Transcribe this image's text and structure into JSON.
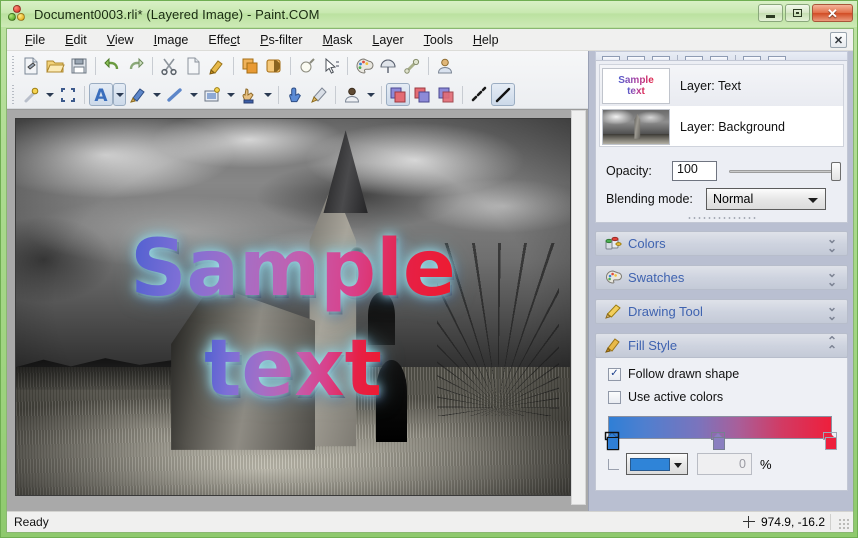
{
  "window": {
    "title": "Document0003.rli* (Layered Image) - Paint.COM",
    "app_icon": "paint-palette-icon",
    "minimize_label": "Minimize",
    "maximize_label": "Maximize",
    "close_label": "✕"
  },
  "menubar": {
    "items": [
      {
        "label": "File",
        "accel": "F"
      },
      {
        "label": "Edit",
        "accel": "E"
      },
      {
        "label": "View",
        "accel": "V"
      },
      {
        "label": "Image",
        "accel": "I"
      },
      {
        "label": "Effect",
        "accel": "c"
      },
      {
        "label": "Ps-filter",
        "accel": "P"
      },
      {
        "label": "Mask",
        "accel": "M"
      },
      {
        "label": "Layer",
        "accel": "L"
      },
      {
        "label": "Tools",
        "accel": "T"
      },
      {
        "label": "Help",
        "accel": "H"
      }
    ],
    "close_doc_label": "✕"
  },
  "toolbar_top": [
    {
      "name": "new-document-icon",
      "tip": "New"
    },
    {
      "name": "open-folder-icon",
      "tip": "Open"
    },
    {
      "name": "save-disk-icon",
      "tip": "Save"
    },
    {
      "name": "separator"
    },
    {
      "name": "undo-icon",
      "tip": "Undo"
    },
    {
      "name": "redo-icon",
      "tip": "Redo"
    },
    {
      "name": "separator"
    },
    {
      "name": "cut-scissors-icon",
      "tip": "Cut"
    },
    {
      "name": "copy-icon",
      "tip": "Copy"
    },
    {
      "name": "paste-brush-icon",
      "tip": "Paste"
    },
    {
      "name": "separator"
    },
    {
      "name": "layers-orange-icon",
      "tip": "Layers"
    },
    {
      "name": "mask-icon",
      "tip": "Mask"
    },
    {
      "name": "separator"
    },
    {
      "name": "bulb-icon",
      "tip": "Light"
    },
    {
      "name": "select-pointer-icon",
      "tip": "Select"
    },
    {
      "name": "separator"
    },
    {
      "name": "palette-icon",
      "tip": "Colors"
    },
    {
      "name": "swatch-umbrella-icon",
      "tip": "Swatches"
    },
    {
      "name": "bone-tool-icon",
      "tip": "Tool"
    },
    {
      "name": "separator"
    },
    {
      "name": "person-icon",
      "tip": "Person"
    }
  ],
  "toolbar_bottom": [
    {
      "name": "magic-wand-icon",
      "tip": "Magic wand",
      "dropdown": true
    },
    {
      "name": "crop-frame-icon",
      "tip": "Crop"
    },
    {
      "name": "separator"
    },
    {
      "name": "text-tool-icon",
      "tip": "Text tool",
      "selected": true,
      "dropdown": true,
      "boxed": true
    },
    {
      "name": "paintbrush-icon",
      "tip": "Brush",
      "dropdown": true
    },
    {
      "name": "line-tool-icon",
      "tip": "Line",
      "dropdown": true
    },
    {
      "name": "shape-tool-icon",
      "tip": "Shape",
      "dropdown": true
    },
    {
      "name": "hand-stamp-icon",
      "tip": "Stamp",
      "dropdown": true
    },
    {
      "name": "separator"
    },
    {
      "name": "finger-smudge-icon",
      "tip": "Smudge"
    },
    {
      "name": "eraser-brush-icon",
      "tip": "Eraser"
    },
    {
      "name": "separator"
    },
    {
      "name": "avatar-tool-icon",
      "tip": "Avatar",
      "dropdown": true
    },
    {
      "name": "separator"
    },
    {
      "name": "layer-front-icon",
      "tip": "Bring to front",
      "selected": true
    },
    {
      "name": "layer-middle-icon",
      "tip": "Middle"
    },
    {
      "name": "layer-back-icon",
      "tip": "Send to back"
    },
    {
      "name": "separator"
    },
    {
      "name": "dashed-line-icon",
      "tip": "Dashed line"
    },
    {
      "name": "solid-line-icon",
      "tip": "Solid line",
      "selected": true
    }
  ],
  "canvas": {
    "artwork_line1": "Sample",
    "artwork_line2": "text",
    "background_description": "black and white photo of ruined church with dramatic clouds"
  },
  "dock": {
    "layers": {
      "rows": [
        {
          "name": "Layer: Text",
          "thumb": "sample-text-thumb",
          "thumb_text_1": "Sample",
          "thumb_text_2": "text",
          "selected": true
        },
        {
          "name": "Layer: Background",
          "thumb": "church-photo-thumb",
          "selected": false
        }
      ],
      "opacity_label": "Opacity:",
      "opacity_value": "100",
      "blending_label": "Blending mode:",
      "blending_value": "Normal",
      "blending_options": [
        "Normal"
      ]
    },
    "sections": [
      {
        "id": "colors",
        "label": "Colors",
        "icon": "paint-cans-icon",
        "expanded": false,
        "chevron": "down"
      },
      {
        "id": "swatches",
        "label": "Swatches",
        "icon": "palette-icon",
        "expanded": false,
        "chevron": "down"
      },
      {
        "id": "drawing",
        "label": "Drawing Tool",
        "icon": "pencil-icon",
        "expanded": false,
        "chevron": "down"
      },
      {
        "id": "fill",
        "label": "Fill Style",
        "icon": "paintbrush-icon",
        "expanded": true,
        "chevron": "up"
      }
    ],
    "fill_style": {
      "follow_shape_label": "Follow drawn shape",
      "follow_shape_checked": true,
      "use_active_colors_label": "Use active colors",
      "use_active_colors_checked": false,
      "gradient": {
        "start_color": "#2f7fd6",
        "mid_color": "#8a7fc0",
        "end_color": "#ee1f3c",
        "stops": [
          0,
          47,
          100
        ]
      },
      "selected_color": "#2f84d8",
      "percent_value": "0",
      "percent_sign": "%"
    }
  },
  "statusbar": {
    "message": "Ready",
    "coordinates": "974.9, -16.2",
    "coord_icon": "crosshair-icon"
  }
}
